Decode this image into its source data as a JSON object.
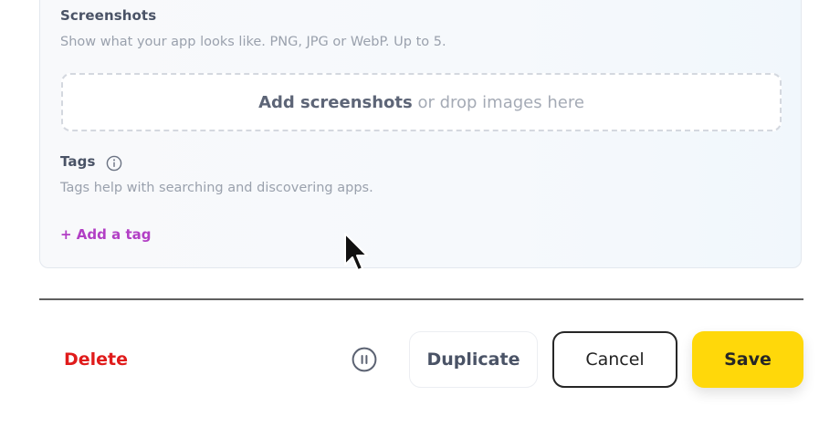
{
  "screenshots": {
    "title": "Screenshots",
    "description": "Show what your app looks like. PNG, JPG or WebP. Up to 5.",
    "dropzone_action": "Add screenshots",
    "dropzone_hint": " or drop images here"
  },
  "tags": {
    "title": "Tags",
    "info_icon": "info-icon",
    "description": "Tags help with searching and discovering apps.",
    "add_label": "+ Add a tag"
  },
  "footer": {
    "delete_label": "Delete",
    "pause_icon": "pause-circle-icon",
    "duplicate_label": "Duplicate",
    "cancel_label": "Cancel",
    "save_label": "Save"
  },
  "colors": {
    "delete": "#e01b1b",
    "add_tag": "#b23fc5",
    "save_bg": "#ffd80a"
  }
}
